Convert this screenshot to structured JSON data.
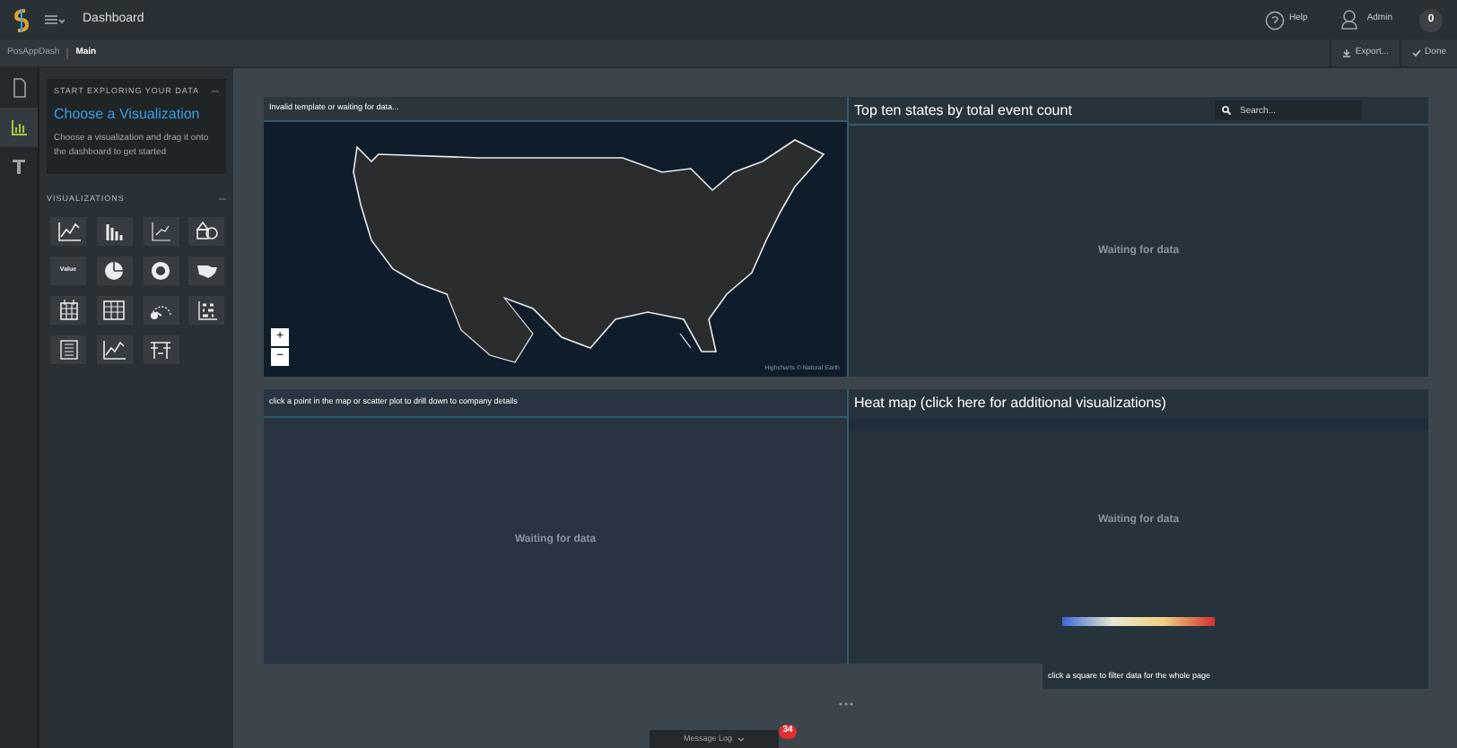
{
  "header": {
    "title": "Dashboard",
    "help": "Help",
    "user": "Admin",
    "notifications": "0"
  },
  "breadcrumb": [
    "PosAppDash",
    "Main"
  ],
  "actions": [
    {
      "kind": "export",
      "label": "Export..."
    },
    {
      "kind": "done",
      "label": "Done"
    }
  ],
  "rail": [
    {
      "kind": "page",
      "selected": false
    },
    {
      "kind": "chart",
      "selected": true
    },
    {
      "kind": "filter",
      "selected": false
    }
  ],
  "intro": {
    "heading": "START EXPLORING YOUR DATA",
    "title": "Choose a Visualization",
    "text": "Choose a visualization and drag it onto the dashboard to get started"
  },
  "visualizations": {
    "heading": "VISUALIZATIONS",
    "items": [
      {
        "kind": "line"
      },
      {
        "kind": "bar"
      },
      {
        "kind": "scatter"
      },
      {
        "kind": "shapes"
      },
      {
        "kind": "value",
        "label": "Value"
      },
      {
        "kind": "pie"
      },
      {
        "kind": "donut"
      },
      {
        "kind": "map"
      },
      {
        "kind": "calendar"
      },
      {
        "kind": "table"
      },
      {
        "kind": "gauge"
      },
      {
        "kind": "heatmap"
      },
      {
        "kind": "list"
      },
      {
        "kind": "line"
      },
      {
        "kind": "pivot"
      }
    ]
  },
  "map_widget": {
    "caption": "Invalid template or waiting for data...",
    "zoom_in": "+",
    "zoom_out": "−",
    "credit": "Highcharts © Natural Earth"
  },
  "table_widget": {
    "title": "Top ten states by total event count",
    "search": {
      "placeholder": "Search..."
    },
    "status": "Waiting for data"
  },
  "scatter_widget": {
    "caption": "click a point in the map or scatter plot to drill down to company details",
    "status": "Waiting for data"
  },
  "heatmap_widget": {
    "title": "Heat map (click here for additional visualizations)",
    "status": "Waiting for data",
    "caption": "click a square to filter data for the whole page"
  },
  "message_log": {
    "label": "Message Log",
    "count": "34"
  }
}
